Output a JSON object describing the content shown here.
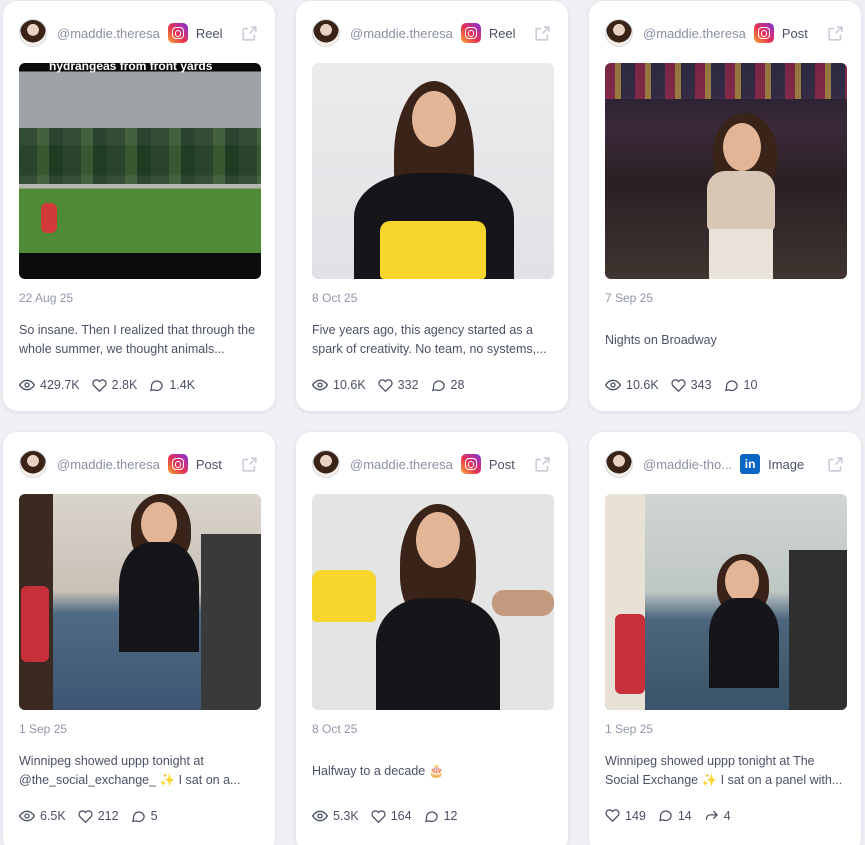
{
  "cards": [
    {
      "handle": "@maddie.theresa",
      "platform": "instagram",
      "post_type": "Reel",
      "date": "22 Aug 25",
      "caption": "So insane. Then I realized that through the whole summer, we thought animals...",
      "overlay_text": "hydrangeas from front yards",
      "stats": {
        "views": "429.7K",
        "likes": "2.8K",
        "comments": "1.4K"
      }
    },
    {
      "handle": "@maddie.theresa",
      "platform": "instagram",
      "post_type": "Reel",
      "date": "8 Oct 25",
      "caption": "Five years ago, this agency started as a spark of creativity. No team, no systems,...",
      "stats": {
        "views": "10.6K",
        "likes": "332",
        "comments": "28"
      }
    },
    {
      "handle": "@maddie.theresa",
      "platform": "instagram",
      "post_type": "Post",
      "date": "7 Sep 25",
      "caption": "Nights on Broadway",
      "stats": {
        "views": "10.6K",
        "likes": "343",
        "comments": "10"
      }
    },
    {
      "handle": "@maddie.theresa",
      "platform": "instagram",
      "post_type": "Post",
      "date": "1 Sep 25",
      "caption": "Winnipeg showed uppp tonight at @the_social_exchange_ ✨ I sat on a...",
      "stats": {
        "views": "6.5K",
        "likes": "212",
        "comments": "5"
      }
    },
    {
      "handle": "@maddie.theresa",
      "platform": "instagram",
      "post_type": "Post",
      "date": "8 Oct 25",
      "caption": "Halfway to a decade 🎂",
      "stats": {
        "views": "5.3K",
        "likes": "164",
        "comments": "12"
      }
    },
    {
      "handle": "@maddie-tho...",
      "platform": "linkedin",
      "platform_icon_text": "in",
      "post_type": "Image",
      "date": "1 Sep 25",
      "caption": "Winnipeg showed uppp tonight at The Social Exchange ✨ I sat on a panel with...",
      "stats": {
        "likes": "149",
        "comments": "14",
        "shares": "4"
      }
    }
  ],
  "colors": {
    "page_bg": "#eef0f5",
    "card_bg": "#ffffff",
    "muted_text": "#8a90a3",
    "body_text": "#4b5266",
    "linkedin_blue": "#0a66c2"
  },
  "icons": [
    "instagram-icon",
    "linkedin-icon",
    "external-link-icon",
    "eye-icon",
    "heart-icon",
    "comment-icon",
    "share-icon"
  ]
}
